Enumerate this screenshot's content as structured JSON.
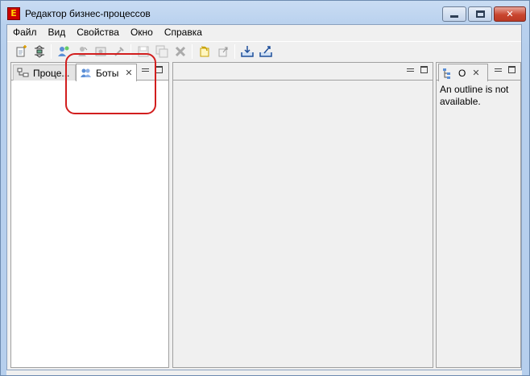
{
  "window": {
    "title": "Редактор бизнес-процессов",
    "app_icon_letter": "E",
    "controls": [
      "minimize-button",
      "maximize-button",
      "close-button"
    ]
  },
  "menu": [
    "Файл",
    "Вид",
    "Свойства",
    "Окно",
    "Справка"
  ],
  "toolbar": {
    "icons": [
      "new-file-icon",
      "sync-icon",
      "bot-add-icon",
      "bot-connect-icon",
      "bot-edit-icon",
      "bot-tool-icon",
      "save-icon",
      "save-all-icon",
      "delete-icon",
      "undo-icon",
      "export-icon",
      "import-icon",
      "deploy-icon"
    ]
  },
  "left_view": {
    "tabs": [
      {
        "label": "Проце...",
        "icon": "process-tree-icon",
        "active": false
      },
      {
        "label": "Боты",
        "icon": "bots-icon",
        "active": true
      }
    ]
  },
  "outline_view": {
    "tab_label": "O",
    "message": "An outline is not available."
  },
  "accent": {
    "highlight": "#d21e1e",
    "close_button": "#c9462f"
  }
}
